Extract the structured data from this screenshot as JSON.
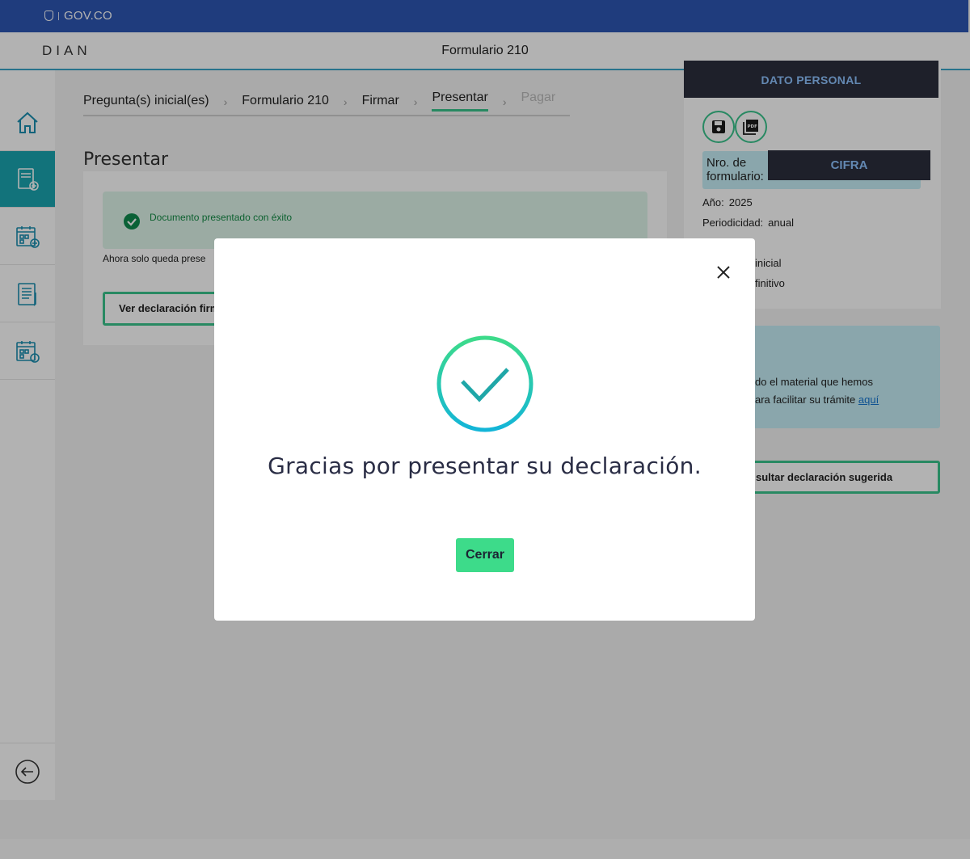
{
  "govbar": {
    "logo_text": "GOV.CO"
  },
  "header": {
    "brand": "DIAN",
    "title": "Formulario 210"
  },
  "sidebar": {
    "items": [
      {
        "icon": "home-icon"
      },
      {
        "icon": "form-210-add-icon",
        "active": true
      },
      {
        "icon": "calendar-add-icon"
      },
      {
        "icon": "document-list-icon"
      },
      {
        "icon": "calendar-payment-icon"
      }
    ],
    "back_icon": "back-arrow-icon"
  },
  "breadcrumb": {
    "steps": [
      {
        "label": "Pregunta(s) inicial(es)"
      },
      {
        "label": "Formulario 210"
      },
      {
        "label": "Firmar"
      },
      {
        "label": "Presentar"
      },
      {
        "label": "Pagar"
      }
    ]
  },
  "main": {
    "title": "Presentar",
    "success_message": "Documento presentado con éxito",
    "now_text": "Ahora solo queda prese",
    "view_button": "Ver declaración firm"
  },
  "right_panel": {
    "header": "DATO PERSONAL",
    "nro_label": "Nro. de formulario:",
    "cifra": "CIFRA",
    "year_label": "Año:",
    "year_value": "2025",
    "period_label": "Periodicidad:",
    "period_value": "anual",
    "line3": "inicial",
    "line4": "finitivo",
    "info_line1": "do el material que hemos",
    "info_line2": "ara facilitar su trámite",
    "info_link": "aquí",
    "consult_button": "sultar declaración sugerida"
  },
  "modal": {
    "message": "Gracias por presentar su declaración.",
    "close_button": "Cerrar"
  },
  "colors": {
    "gov_blue": "#2d56b3",
    "accent_green": "#3ac48d",
    "button_green": "#3ddb8a",
    "sidebar_active": "#1aa5b0",
    "dark_label": "#2b2f3d",
    "info_bg": "#c6eef6"
  }
}
